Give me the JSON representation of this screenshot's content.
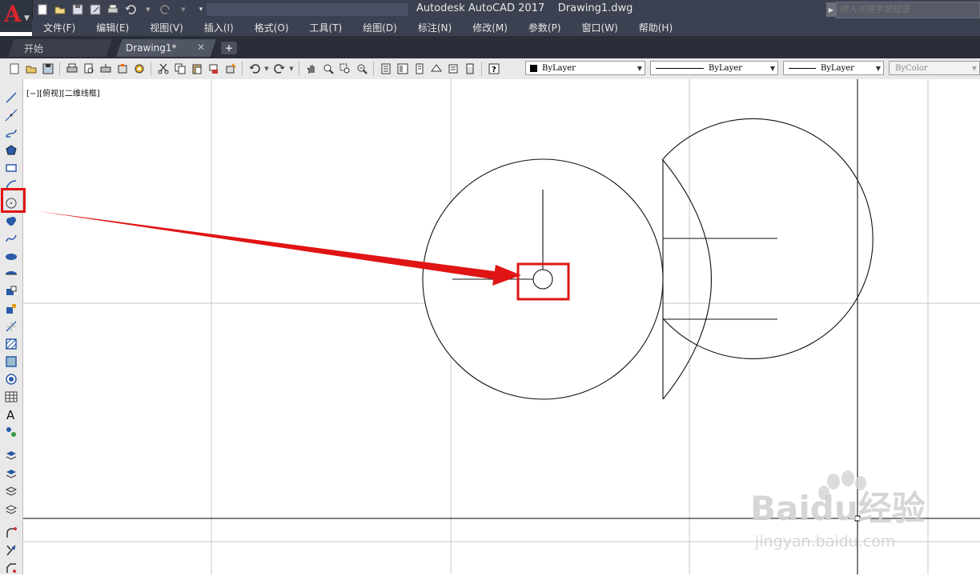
{
  "app": {
    "title": "Autodesk AutoCAD 2017    Drawing1.dwg",
    "search_placeholder": "键入关键字或短语",
    "logo_letter": "A"
  },
  "menu": [
    "文件(F)",
    "编辑(E)",
    "视图(V)",
    "插入(I)",
    "格式(O)",
    "工具(T)",
    "绘图(D)",
    "标注(N)",
    "修改(M)",
    "参数(P)",
    "窗口(W)",
    "帮助(H)"
  ],
  "tabs": {
    "start": "开始",
    "drawing": "Drawing1*",
    "close_glyph": "✕",
    "add_glyph": "+"
  },
  "properties": {
    "color": "ByLayer",
    "linetype": "ByLayer",
    "lineweight": "ByLayer",
    "plotstyle": "ByColor"
  },
  "viewport_label": "[−][俯视][二维线框]",
  "watermark": {
    "brand": "Baidu经验",
    "url": "jingyan.baidu.com"
  },
  "colors": {
    "highlight": "#e01414",
    "titlebar": "#3b4150",
    "logo": "#d8262b"
  },
  "icons": {
    "left_toolbar": [
      "line-icon",
      "construction-line-icon",
      "polyline-icon",
      "polygon-icon",
      "rectangle-icon",
      "arc-icon",
      "circle-icon",
      "revision-cloud-icon",
      "spline-icon",
      "ellipse-icon",
      "ellipse-arc-icon",
      "insert-block-icon",
      "make-block-icon",
      "point-icon",
      "hatch-icon",
      "gradient-icon",
      "region-icon",
      "table-icon",
      "multiline-text-icon",
      "add-selected-icon",
      "layer-icon",
      "layer-prev-icon",
      "layer-iso-icon",
      "layer-freeze-icon",
      "fillet-icon",
      "trim-icon",
      "chamfer-icon"
    ]
  }
}
